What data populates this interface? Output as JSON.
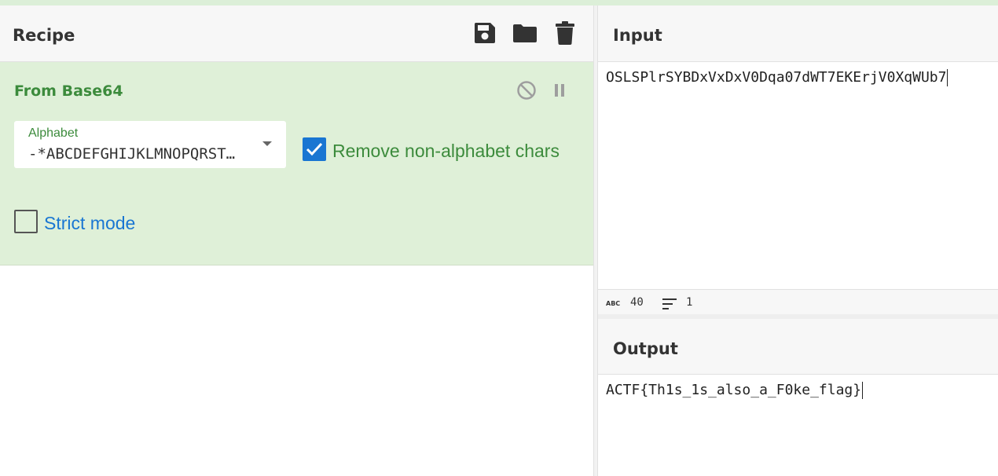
{
  "recipe": {
    "title": "Recipe",
    "buttons": {
      "save": "save-icon",
      "load": "folder-icon",
      "clear": "trash-icon"
    },
    "operation": {
      "name": "From Base64",
      "controls": {
        "disable": "disable-icon",
        "breakpoint": "pause-icon"
      },
      "alphabet": {
        "label": "Alphabet",
        "value": "-*ABCDEFGHIJKLMNOPQRSTUVWXYZ"
      },
      "remove_non_alphabet": {
        "label": "Remove non-alphabet chars",
        "checked": true
      },
      "strict_mode": {
        "label": "Strict mode",
        "checked": false
      }
    }
  },
  "input": {
    "title": "Input",
    "text": "OSLSPlrSYBDxVxDxV0Dqa07dWT7EKErjV0XqWUb7",
    "status": {
      "length": "40",
      "lines": "1"
    }
  },
  "output": {
    "title": "Output",
    "text": "ACTF{Th1s_1s_also_a_F0ke_flag}"
  },
  "colors": {
    "operation_bg": "#dff0d8",
    "operation_green": "#3c8b3c",
    "checkbox_blue": "#1976d2",
    "header_bg": "#f7f7f7"
  }
}
